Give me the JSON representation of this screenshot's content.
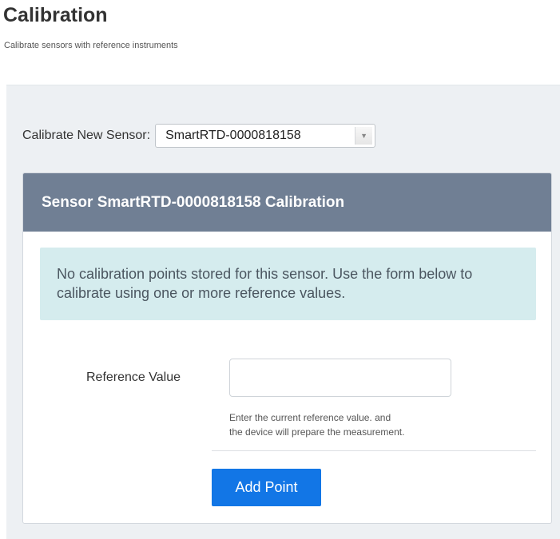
{
  "header": {
    "title": "Calibration",
    "subtitle": "Calibrate sensors with reference instruments"
  },
  "sensor_select": {
    "label": "Calibrate New Sensor:",
    "selected_value": "SmartRTD-0000818158",
    "arrow_icon": "triangle-down-icon"
  },
  "panel": {
    "title": "Sensor SmartRTD-0000818158 Calibration",
    "alert_text": "No calibration points stored for this sensor. Use the form below to calibrate using one or more reference values.",
    "form": {
      "reference_label": "Reference Value",
      "reference_value": "",
      "reference_placeholder": "",
      "help_line1": "Enter the current reference value. and",
      "help_line2": "the device will prepare the measurement.",
      "submit_label": "Add Point"
    }
  },
  "colors": {
    "panel_heading": "#707f94",
    "alert_background": "#d5ecee",
    "primary_button": "#1276e6",
    "content_background": "#edf0f3"
  }
}
